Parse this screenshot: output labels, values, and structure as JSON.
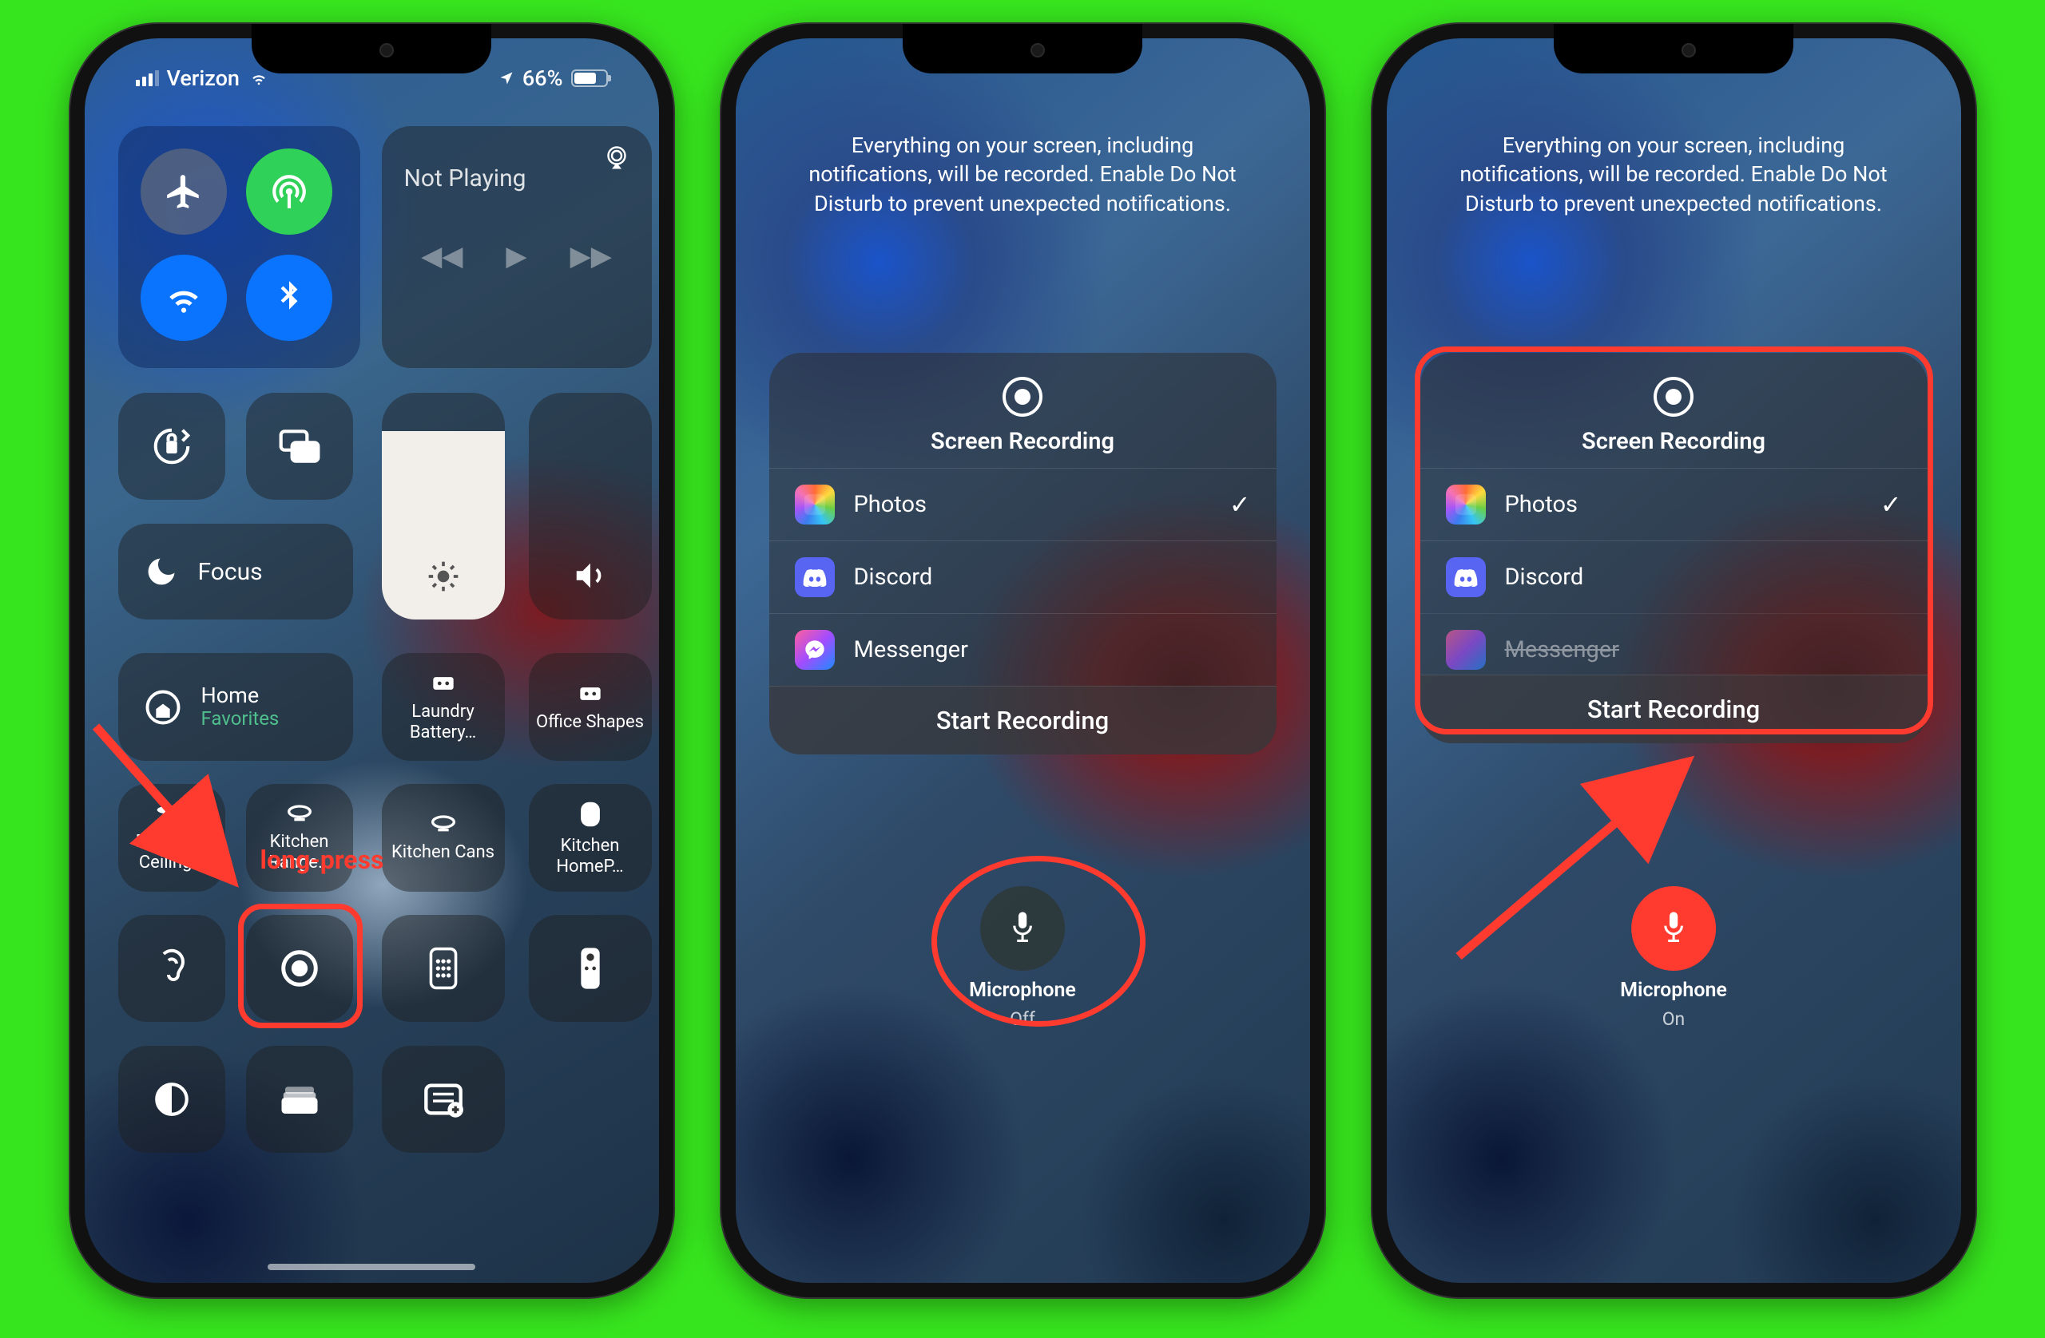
{
  "phone1": {
    "status": {
      "carrier": "Verizon",
      "battery_pct": "66%"
    },
    "connectivity": {
      "airplane": "airplane-icon",
      "cellular": "cellular-icon",
      "wifi": "wifi-icon",
      "bluetooth": "bluetooth-icon"
    },
    "music": {
      "title": "Not Playing"
    },
    "focus": {
      "label": "Focus"
    },
    "home": {
      "label": "Home",
      "sub": "Favorites"
    },
    "shortcuts": {
      "laundry": {
        "label": "Laundry Battery…"
      },
      "office": {
        "label": "Office Shapes"
      },
      "bedroom": {
        "label": "Bedroom Ceiling…"
      },
      "range": {
        "label": "Kitchen Range…"
      },
      "cans": {
        "label": "Kitchen Cans"
      },
      "homepod": {
        "label": "Kitchen HomeP…"
      }
    },
    "annotation": {
      "label": "long-press"
    }
  },
  "recording": {
    "blurb": "Everything on your screen, including notifications, will be recorded. Enable Do Not Disturb to prevent unexpected notifications.",
    "title": "Screen Recording",
    "apps": {
      "photos": "Photos",
      "discord": "Discord",
      "messenger": "Messenger"
    },
    "start": "Start Recording",
    "mic": {
      "label": "Microphone",
      "off": "Off",
      "on": "On"
    }
  }
}
